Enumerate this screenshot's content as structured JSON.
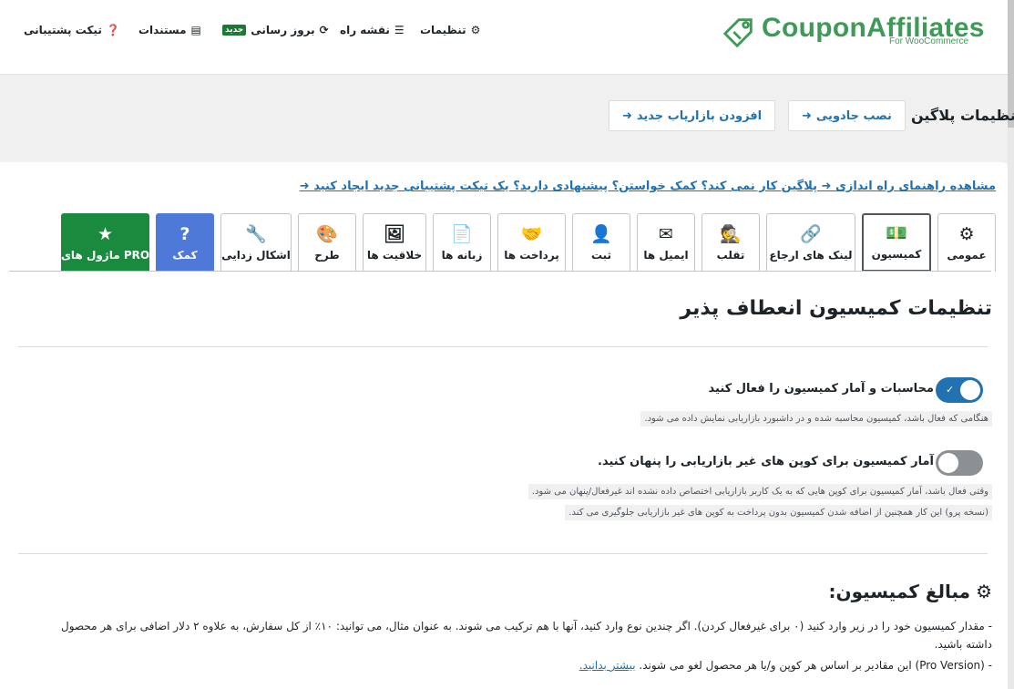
{
  "brand": {
    "name": "CouponAffiliates",
    "sub": "For WooCommerce"
  },
  "topnav": {
    "settings": "تنظیمات",
    "roadmap": "نقشه راه",
    "updates": "بروز رسانی",
    "updates_badge": "جدید",
    "docs": "مستندات",
    "support": "تیکت پشتیبانی"
  },
  "header": {
    "title": "تنظیمات پلاگین",
    "wizard_button": "نصب جادویی",
    "add_affiliate_button": "افزودن بازاریاب جدید"
  },
  "help_line": {
    "guide": "مشاهده راهنمای راه اندازی",
    "question": "پلاگین کار نمی کند؟ کمک خواستن؟ پیشنهادی دارید؟ یک تیکت پشتیبانی جدید ایجاد کنید"
  },
  "tabs": [
    {
      "label": "عمومی",
      "icon": "gear-icon",
      "glyph": "⚙"
    },
    {
      "label": "کمیسیون",
      "icon": "money-icon",
      "glyph": "💵"
    },
    {
      "label": "لینک های ارجاع",
      "icon": "link-icon",
      "glyph": "🔗"
    },
    {
      "label": "تقلب",
      "icon": "detective-icon",
      "glyph": "🕵"
    },
    {
      "label": "ایمیل ها",
      "icon": "envelope-icon",
      "glyph": "✉"
    },
    {
      "label": "ثبت",
      "icon": "user-circle-icon",
      "glyph": "👤"
    },
    {
      "label": "پرداخت ها",
      "icon": "handshake-icon",
      "glyph": "🤝"
    },
    {
      "label": "زبانه ها",
      "icon": "file-plus-icon",
      "glyph": "📄"
    },
    {
      "label": "خلاقیت ها",
      "icon": "images-icon",
      "glyph": "🖼"
    },
    {
      "label": "طرح",
      "icon": "palette-icon",
      "glyph": "🎨"
    },
    {
      "label": "اشکال زدایی",
      "icon": "wrench-icon",
      "glyph": "🔧"
    },
    {
      "label": "کمک",
      "icon": "question-icon",
      "glyph": "?"
    },
    {
      "label": "ماژول های PRO",
      "icon": "star-icon",
      "glyph": "★"
    }
  ],
  "section": {
    "title": "تنظیمات کمیسیون انعطاف پذیر"
  },
  "options": [
    {
      "label": "محاسبات و آمار کمیسیون را فعال کنید",
      "enabled": true,
      "desc": [
        "هنگامی که فعال باشد، کمیسیون محاسبه شده و در داشبورد بازاریابی نمایش داده می شود."
      ]
    },
    {
      "label": "آمار کمیسیون برای کوپن های غیر بازاریابی را پنهان کنید.",
      "enabled": false,
      "desc": [
        "وقتی فعال باشد، آمار کمیسیون برای کوپن هایی که به یک کاربر بازاریابی اختصاص داده نشده اند غیرفعال/پنهان می شود.",
        "(نسخه پرو) این کار همچنین از اضافه شدن کمیسیون بدون پرداخت به کوپن های غیر بازاریابی جلوگیری می کند."
      ]
    }
  ],
  "amounts": {
    "title": "مبالغ کمیسیون:",
    "line1": "- مقدار کمیسیون خود را در زیر وارد کنید (۰ برای غیرفعال کردن). اگر چندین نوع وارد کنید، آنها با هم ترکیب می شوند. به عنوان مثال، می توانید: ۱۰٪ از کل سفارش، به علاوه ۲ دلار اضافی برای هر محصول",
    "line1b": "داشته باشید.",
    "line2": "- (Pro Version) این مقادیر بر اساس هر کوپن و/یا هر محصول لغو می شوند.",
    "learn_more": "بیشتر بدانید."
  },
  "colors": {
    "brand": "#3f9a57",
    "link": "#2271b1",
    "toggle_on": "#2271b1",
    "help_tab": "#4f79d9",
    "pro_tab": "#1a8a3e"
  }
}
